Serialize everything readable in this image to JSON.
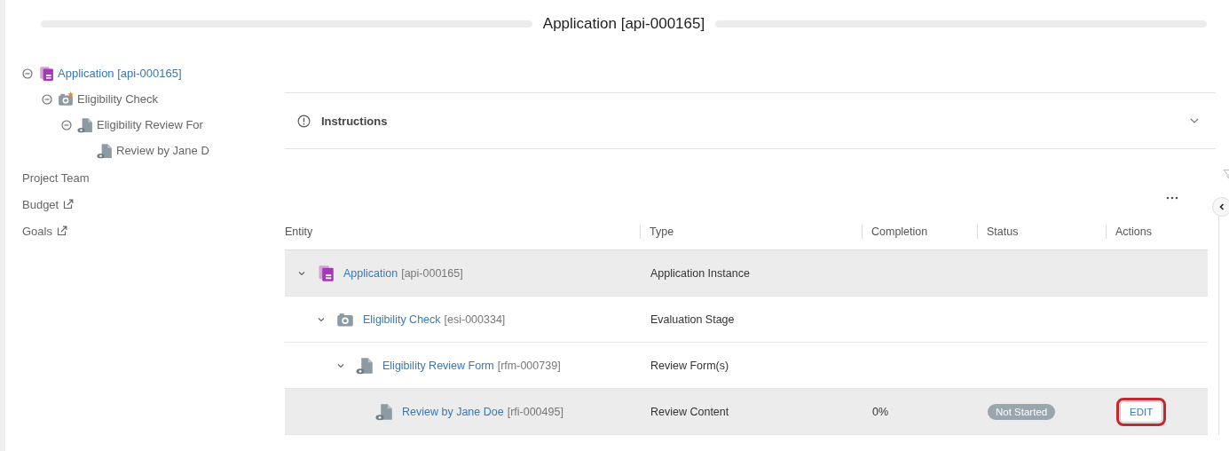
{
  "header": {
    "title": "Application [api-000165]"
  },
  "sidebar": {
    "tree": [
      {
        "label": "Application [api-000165]",
        "kind": "application",
        "expanded": true,
        "selected": true,
        "children": [
          {
            "label": "Eligibility Check",
            "kind": "stage",
            "expanded": true,
            "selected": false,
            "children": [
              {
                "label": "Eligibility Review For",
                "kind": "form",
                "expanded": true,
                "selected": false,
                "children": [
                  {
                    "label": "Review by Jane D",
                    "kind": "form",
                    "selected": false
                  }
                ]
              }
            ]
          }
        ]
      }
    ],
    "links": [
      {
        "label": "Project Team",
        "external": false
      },
      {
        "label": "Budget",
        "external": true
      },
      {
        "label": "Goals",
        "external": true
      }
    ]
  },
  "instructions": {
    "label": "Instructions",
    "expanded": false
  },
  "table": {
    "columns": [
      "Entity",
      "Type",
      "Completion",
      "Status",
      "Actions"
    ],
    "rows": [
      {
        "name": "Application",
        "code": "[api-000165]",
        "kind": "application",
        "type": "Application Instance",
        "expanded": true,
        "selected": true,
        "children": [
          {
            "name": "Eligibility Check",
            "code": "[esi-000334]",
            "kind": "stage",
            "type": "Evaluation Stage",
            "expanded": true,
            "selected": false,
            "children": [
              {
                "name": "Eligibility Review Form",
                "code": "[rfm-000739]",
                "kind": "form",
                "type": "Review Form(s)",
                "expanded": true,
                "selected": false,
                "children": [
                  {
                    "name": "Review by Jane Doe",
                    "code": "[rfi-000495]",
                    "kind": "form",
                    "type": "Review Content",
                    "completion": "0%",
                    "status": "Not Started",
                    "action": {
                      "label": "EDIT",
                      "highlighted": true
                    },
                    "selected": true
                  }
                ]
              }
            ]
          }
        ]
      }
    ]
  }
}
